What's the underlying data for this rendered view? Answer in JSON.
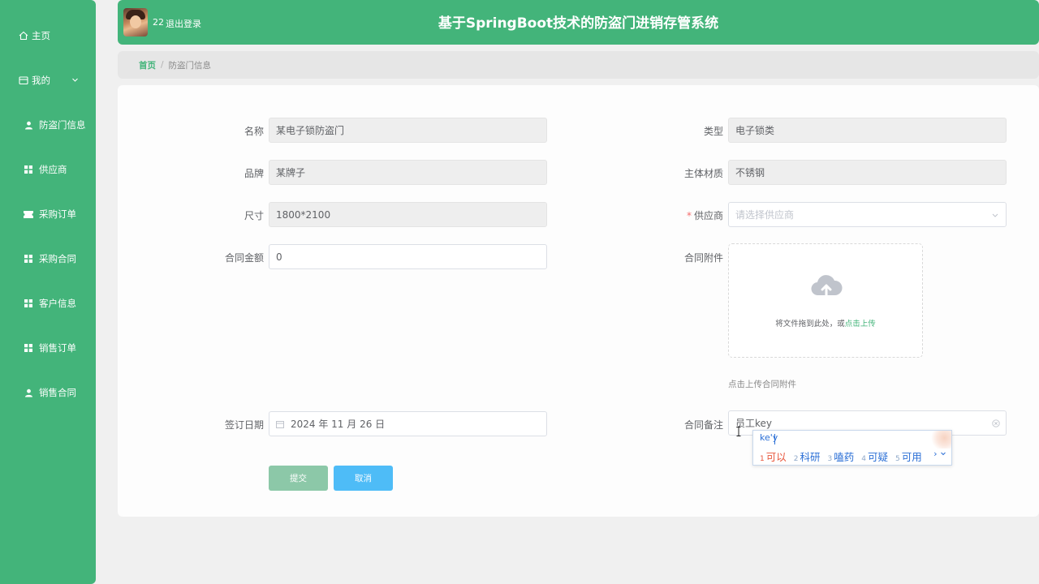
{
  "sidebar": {
    "items": [
      {
        "label": "主页",
        "icon": "home-icon"
      },
      {
        "label": "我的",
        "icon": "panel-icon"
      },
      {
        "label": "防盗门信息",
        "icon": "user-icon"
      },
      {
        "label": "供应商",
        "icon": "grid-icon"
      },
      {
        "label": "采购订单",
        "icon": "ticket-icon"
      },
      {
        "label": "采购合同",
        "icon": "grid-icon"
      },
      {
        "label": "客户信息",
        "icon": "grid-icon"
      },
      {
        "label": "销售订单",
        "icon": "grid-icon"
      },
      {
        "label": "销售合同",
        "icon": "user-icon"
      }
    ]
  },
  "header": {
    "username": "22",
    "logout": "退出登录",
    "title": "基于SpringBoot技术的防盗门进销存管系统"
  },
  "breadcrumb": {
    "home": "首页",
    "separator": "/",
    "current": "防盗门信息"
  },
  "form": {
    "name": {
      "label": "名称",
      "value": "某电子锁防盗门"
    },
    "type": {
      "label": "类型",
      "value": "电子锁类"
    },
    "brand": {
      "label": "品牌",
      "value": "某牌子"
    },
    "material": {
      "label": "主体材质",
      "value": "不锈钢"
    },
    "size": {
      "label": "尺寸",
      "value": "1800*2100"
    },
    "supplier": {
      "label": "供应商",
      "required_mark": "*",
      "placeholder": "请选择供应商"
    },
    "amount": {
      "label": "合同金额",
      "value": "0"
    },
    "attachment": {
      "label": "合同附件",
      "drag_text": "将文件拖到此处，或",
      "click_text": "点击上传",
      "tip": "点击上传合同附件"
    },
    "sign_date": {
      "label": "签订日期",
      "value": "2024 年 11 月 26 日"
    },
    "remark": {
      "label": "合同备注",
      "value": "员工key"
    },
    "submit": "提交",
    "cancel": "取消"
  },
  "ime": {
    "composition": "ke'y",
    "candidates": [
      {
        "num": "1",
        "text": "可以"
      },
      {
        "num": "2",
        "text": "科研"
      },
      {
        "num": "3",
        "text": "嗑药"
      },
      {
        "num": "4",
        "text": "可疑"
      },
      {
        "num": "5",
        "text": "可用"
      }
    ],
    "more": "›"
  },
  "colors": {
    "primary": "#43b47a",
    "submit": "#8cc8a8",
    "cancel": "#4ebcf7",
    "required": "#f56c6c"
  }
}
